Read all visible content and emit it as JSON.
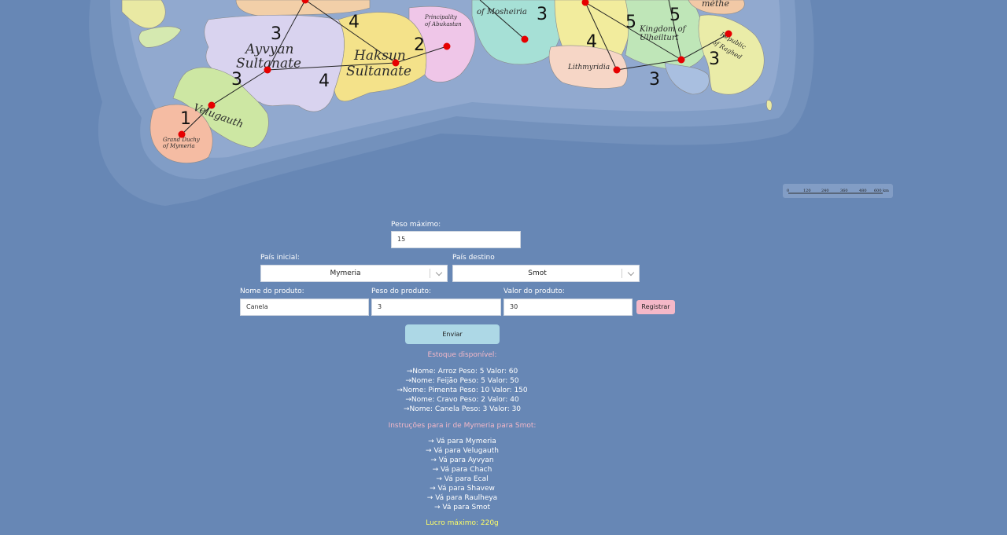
{
  "map": {
    "labels": {
      "ayvyan": [
        "Ayvyan",
        "Sultanate"
      ],
      "haksun": [
        "Haksun",
        "Sultanate"
      ],
      "velugauth": "Velugauth",
      "mymeria": [
        "Grand Duchy",
        "of Mymeria"
      ],
      "abukastan": [
        "Principality",
        "of Abukastan"
      ],
      "mosheiria": "of Mosheiria",
      "lithmyridia": "Lithmyridia",
      "ulheilturt": [
        "Kingdom of",
        "Ulheilturt"
      ],
      "raghed": [
        "Republic",
        "of Raghed"
      ],
      "smethe": "mèthe"
    },
    "edge_weights": [
      "1",
      "3",
      "3",
      "4",
      "4",
      "2",
      "3",
      "4",
      "5",
      "5",
      "3",
      "3"
    ],
    "scale_bar": {
      "ticks": [
        "0",
        "120",
        "240",
        "360",
        "480",
        "600 km"
      ]
    }
  },
  "form": {
    "max_weight": {
      "label": "Peso máximo:",
      "value": "15"
    },
    "start_country": {
      "label": "País inicial:",
      "value": "Mymeria"
    },
    "dest_country": {
      "label": "País destino",
      "value": "Smot"
    },
    "product_name": {
      "label": "Nome do produto:",
      "value": "Canela"
    },
    "product_weight": {
      "label": "Peso do produto:",
      "value": "3"
    },
    "product_value": {
      "label": "Valor do produto:",
      "value": "30"
    },
    "register_label": "Registrar",
    "send_label": "Enviar"
  },
  "stock": {
    "title": "Estoque disponível:",
    "items": [
      "→Nome: Arroz Peso: 5 Valor: 60",
      "→Nome: Feijão Peso: 5 Valor: 50",
      "→Nome: Pimenta Peso: 10 Valor: 150",
      "→Nome: Cravo Peso: 2 Valor: 40",
      "→Nome: Canela Peso: 3 Valor: 30"
    ]
  },
  "route": {
    "title": "Instruções para ir de Mymeria para Smot:",
    "steps": [
      "→ Vá para Mymeria",
      "→ Vá para Velugauth",
      "→ Vá para Ayvyan",
      "→ Vá para Chach",
      "→ Vá para Ecal",
      "→ Vá para Shavew",
      "→ Vá para Raulheya",
      "→ Vá para Smot"
    ]
  },
  "result": {
    "profit": "Lucro máximo: 220g"
  },
  "colors": {
    "page_background": "#6787b5",
    "stock_title": "#f4b8c8",
    "profit": "#ffff66",
    "register_button": "#f4b8c8",
    "send_button": "#add8e6",
    "route_node": "#e60000"
  }
}
